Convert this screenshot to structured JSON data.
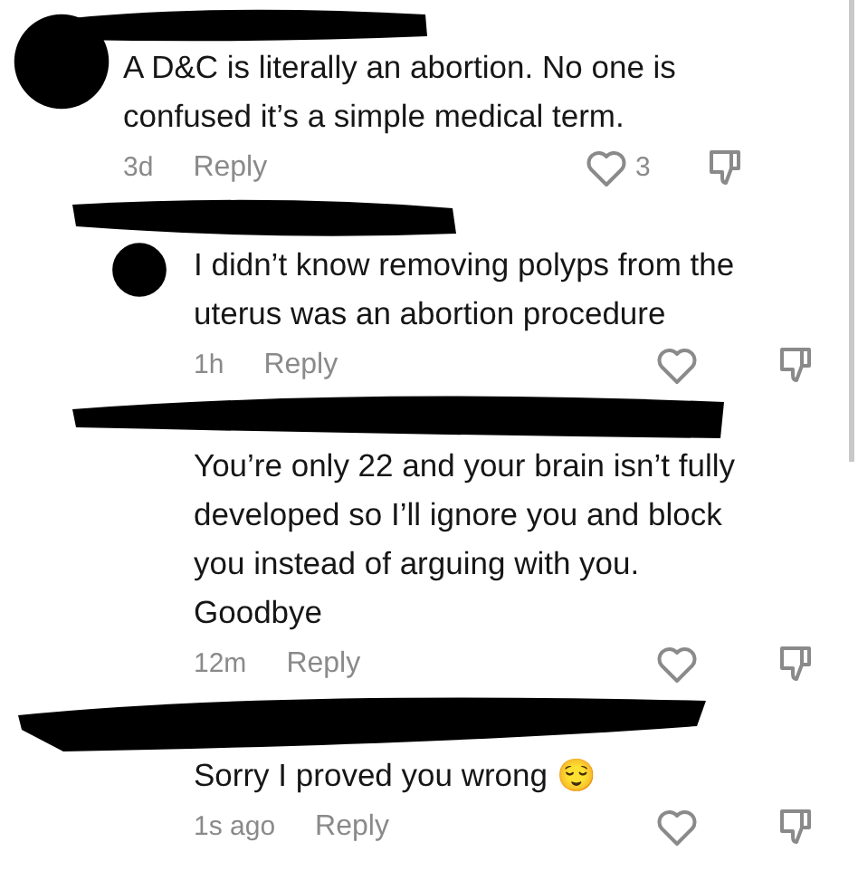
{
  "comments": [
    {
      "is_reply": false,
      "text": "A D&C is literally an abortion. No one is confused it’s a simple medical term.",
      "time": "3d",
      "reply_label": "Reply",
      "likes": "3"
    },
    {
      "is_reply": true,
      "text": "I didn’t know removing polyps from the uterus was an abortion procedure",
      "time": "1h",
      "reply_label": "Reply"
    },
    {
      "is_reply": true,
      "text": "You’re only 22 and your brain isn’t fully developed so I’ll ignore you and block you instead of arguing with you. Goodbye",
      "time": "12m",
      "reply_label": "Reply"
    },
    {
      "is_reply": true,
      "text": "Sorry I proved you wrong 😌",
      "time": "1s ago",
      "reply_label": "Reply"
    }
  ]
}
